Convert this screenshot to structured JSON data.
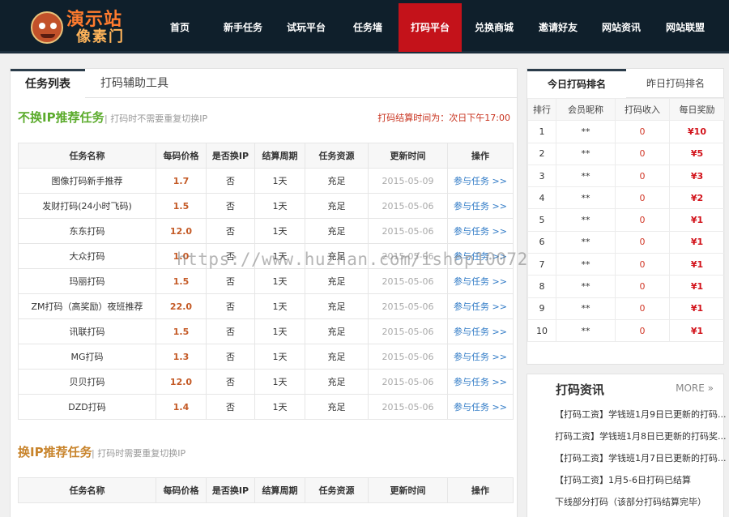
{
  "logo": {
    "line1": "演示站",
    "line2": "像素门"
  },
  "nav": [
    "首页",
    "新手任务",
    "试玩平台",
    "任务墙",
    "打码平台",
    "兑换商城",
    "邀请好友",
    "网站资讯",
    "网站联盟"
  ],
  "nav_active_index": 4,
  "colors": {
    "nav_bg": "#0f1f2b",
    "nav_active": "#c4121a",
    "accent_green": "#5bab2c",
    "accent_orange": "#c8842c",
    "price": "#c45a26",
    "link": "#2f7ac6",
    "bonus": "#d2121a"
  },
  "main": {
    "tabs": [
      "任务列表",
      "打码辅助工具"
    ],
    "section1": {
      "title": "不换IP推荐任务",
      "subtitle": "| 打码时不需要重复切换IP",
      "notice": "打码结算时间为：次日下午17:00"
    },
    "columns": [
      "任务名称",
      "每码价格",
      "是否换IP",
      "结算周期",
      "任务资源",
      "更新时间",
      "操作"
    ],
    "rows": [
      [
        "图像打码新手推荐",
        "1.7",
        "否",
        "1天",
        "充足",
        "2015-05-09",
        "参与任务 >>"
      ],
      [
        "发财打码(24小时飞码)",
        "1.5",
        "否",
        "1天",
        "充足",
        "2015-05-06",
        "参与任务 >>"
      ],
      [
        "东东打码",
        "12.0",
        "否",
        "1天",
        "充足",
        "2015-05-06",
        "参与任务 >>"
      ],
      [
        "大众打码",
        "1.0",
        "否",
        "1天",
        "充足",
        "2015-05-06",
        "参与任务 >>"
      ],
      [
        "玛丽打码",
        "1.5",
        "否",
        "1天",
        "充足",
        "2015-05-06",
        "参与任务 >>"
      ],
      [
        "ZM打码（高奖励）夜班推荐",
        "22.0",
        "否",
        "1天",
        "充足",
        "2015-05-06",
        "参与任务 >>"
      ],
      [
        "讯联打码",
        "1.5",
        "否",
        "1天",
        "充足",
        "2015-05-06",
        "参与任务 >>"
      ],
      [
        "MG打码",
        "1.3",
        "否",
        "1天",
        "充足",
        "2015-05-06",
        "参与任务 >>"
      ],
      [
        "贝贝打码",
        "12.0",
        "否",
        "1天",
        "充足",
        "2015-05-06",
        "参与任务 >>"
      ],
      [
        "DZD打码",
        "1.4",
        "否",
        "1天",
        "充足",
        "2015-05-06",
        "参与任务 >>"
      ]
    ],
    "section2": {
      "title": "换IP推荐任务",
      "subtitle": "| 打码时需要重复切换IP"
    }
  },
  "ranking": {
    "tabs": [
      "今日打码排名",
      "昨日打码排名"
    ],
    "columns": [
      "排行",
      "会员昵称",
      "打码收入",
      "每日奖励"
    ],
    "rows": [
      [
        "1",
        "**",
        "0",
        "¥10"
      ],
      [
        "2",
        "**",
        "0",
        "¥5"
      ],
      [
        "3",
        "**",
        "0",
        "¥3"
      ],
      [
        "4",
        "**",
        "0",
        "¥2"
      ],
      [
        "5",
        "**",
        "0",
        "¥1"
      ],
      [
        "6",
        "**",
        "0",
        "¥1"
      ],
      [
        "7",
        "**",
        "0",
        "¥1"
      ],
      [
        "8",
        "**",
        "0",
        "¥1"
      ],
      [
        "9",
        "**",
        "0",
        "¥1"
      ],
      [
        "10",
        "**",
        "0",
        "¥1"
      ]
    ]
  },
  "news": {
    "title": "打码资讯",
    "more": "MORE",
    "items": [
      "【打码工资】学钱班1月9日已更新的打码...",
      "打码工资】学钱班1月8日已更新的打码奖...",
      "【打码工资】学钱班1月7日已更新的打码...",
      "【打码工资】1月5-6日打码已结算",
      "下线部分打码（该部分打码结算完毕）"
    ]
  },
  "watermark": "https://www.huzhan.com/ishop10072"
}
